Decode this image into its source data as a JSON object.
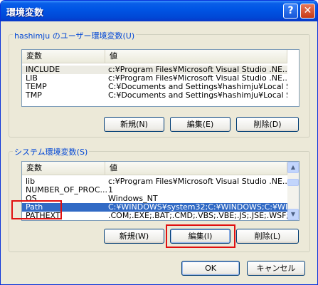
{
  "window": {
    "title": "環境変数"
  },
  "user_group": {
    "label": "hashimju のユーザー環境変数(U)",
    "columns": [
      "変数",
      "値"
    ],
    "rows": [
      {
        "name": "INCLUDE",
        "value": "c:¥Program Files¥Microsoft Visual Studio .NE..."
      },
      {
        "name": "LIB",
        "value": "c:¥Program Files¥Microsoft Visual Studio .NE..."
      },
      {
        "name": "TEMP",
        "value": "C:¥Documents and Settings¥hashimju¥Local S..."
      },
      {
        "name": "TMP",
        "value": "C:¥Documents and Settings¥hashimju¥Local S..."
      }
    ],
    "buttons": {
      "new": "新規(N)",
      "edit": "編集(E)",
      "delete": "削除(D)"
    }
  },
  "system_group": {
    "label": "システム環境変数(S)",
    "columns": [
      "変数",
      "値"
    ],
    "rows": [
      {
        "name": "lib",
        "value": "c:¥Program Files¥Microsoft Visual Studio .NE..."
      },
      {
        "name": "NUMBER_OF_PROC...",
        "value": "1"
      },
      {
        "name": "OS",
        "value": "Windows_NT"
      },
      {
        "name": "Path",
        "value": "C:¥WINDOWS¥system32;C:¥WINDOWS;C:¥WIN...",
        "selected": true
      },
      {
        "name": "PATHEXT",
        "value": ".COM;.EXE;.BAT;.CMD;.VBS;.VBE;.JS;.JSE;.WSF;..."
      }
    ],
    "buttons": {
      "new": "新規(W)",
      "edit": "編集(I)",
      "delete": "削除(L)"
    }
  },
  "dialog_buttons": {
    "ok": "OK",
    "cancel": "キャンセル"
  },
  "colors": {
    "selection": "#316ac5",
    "highlight_box": "#e01010",
    "group_label": "#0046d5"
  }
}
